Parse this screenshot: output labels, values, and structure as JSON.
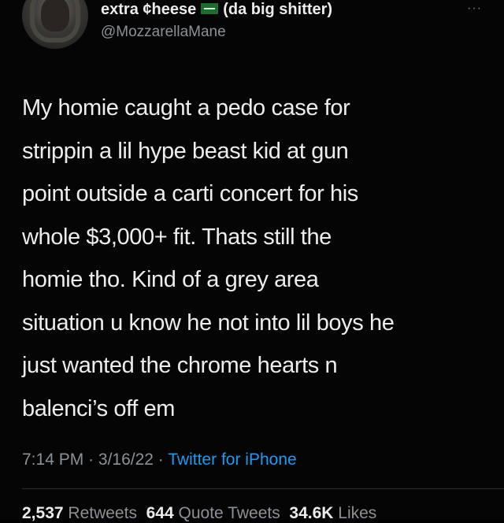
{
  "tweet": {
    "display_name": "extra ¢heese",
    "display_suffix": "(da big shitter)",
    "flag_icon": "flag-icon",
    "handle": "@MozzarellaMane",
    "more_icon": "···",
    "lines": [
      "My homie caught a pedo case for",
      "strippin a lil hype beast kid at gun",
      "point outside a carti concert for his",
      "whole $3,000+ fit. Thats still the",
      "homie tho. Kind of a grey area",
      "situation u know he not into lil boys he",
      "just wanted the chrome hearts n",
      "balenci’s off em"
    ],
    "time": "7:14 PM",
    "date": "3/16/22",
    "separator": " · ",
    "source": "Twitter for iPhone",
    "stats": {
      "retweets_count": "2,537",
      "retweets_label": "Retweets",
      "quotes_count": "644",
      "quotes_label": "Quote Tweets",
      "likes_count": "34.6K",
      "likes_label": "Likes"
    }
  },
  "colors": {
    "background": "#050505",
    "text": "#ededed",
    "secondary": "#8b9197",
    "link": "#1d9bf0"
  }
}
